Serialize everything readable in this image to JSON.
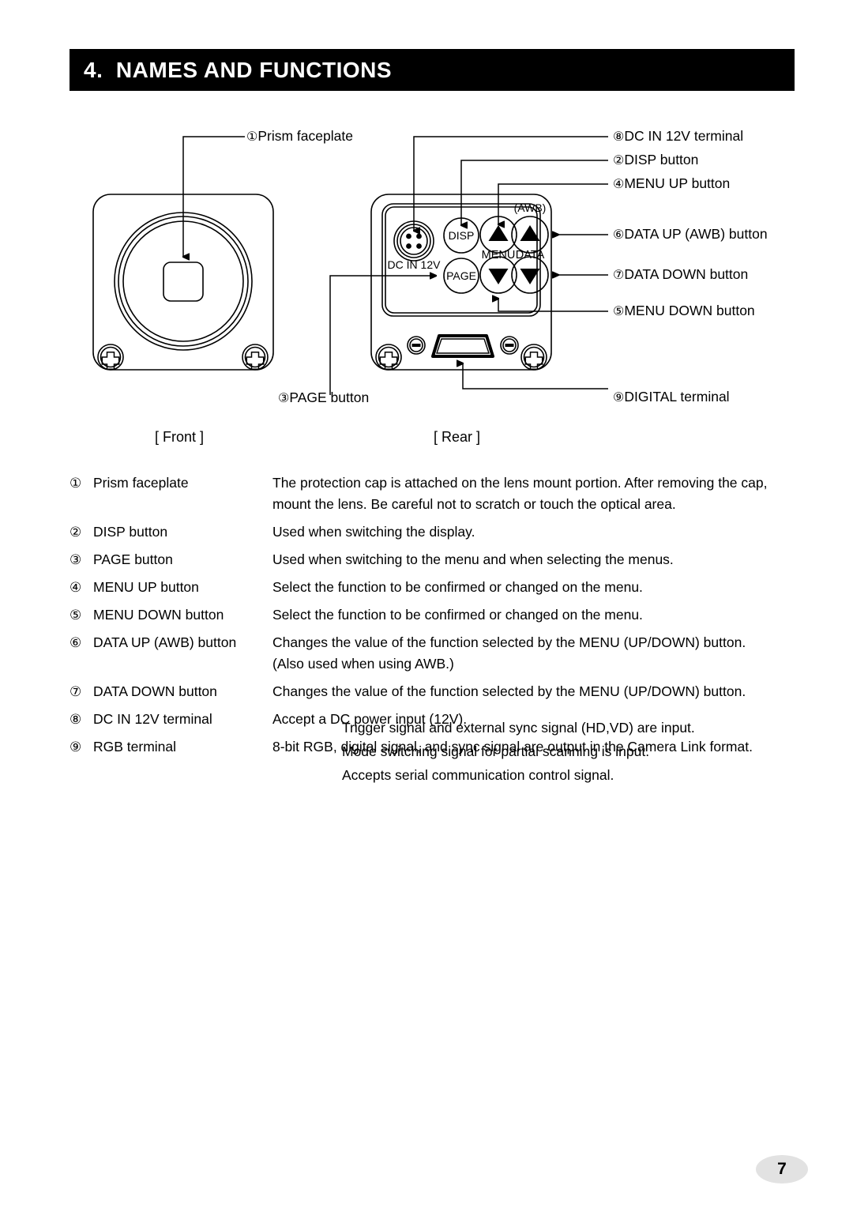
{
  "header": {
    "title": "4.  NAMES AND FUNCTIONS"
  },
  "diagram": {
    "front_view_label": "[ Front ]",
    "rear_view_label": "[ Rear ]",
    "callouts": [
      {
        "num": "①",
        "text": "Prism faceplate"
      },
      {
        "num": "⑧",
        "text": "DC IN 12V terminal"
      },
      {
        "num": "②",
        "text": "DISP button"
      },
      {
        "num": "④",
        "text": "MENU UP button"
      },
      {
        "num": "⑥",
        "text": "DATA UP (AWB) button"
      },
      {
        "num": "⑦",
        "text": "DATA DOWN button"
      },
      {
        "num": "⑤",
        "text": "MENU DOWN button"
      },
      {
        "num": "③",
        "text": "PAGE button"
      },
      {
        "num": "⑨",
        "text": "DIGITAL terminal"
      }
    ],
    "rear_panel_text": {
      "dc_in": "DC IN 12V",
      "disp": "DISP",
      "page": "PAGE",
      "awb": "(AWB)",
      "menu": "MENU",
      "data": "DATA"
    }
  },
  "descriptions": [
    {
      "num": "①",
      "name": "Prism faceplate",
      "lines": [
        "The protection cap is attached on the lens mount portion. After removing the cap,",
        "mount the lens. Be careful not to scratch or touch the optical area."
      ]
    },
    {
      "num": "②",
      "name": "DISP button",
      "lines": [
        "Used when switching the display."
      ]
    },
    {
      "num": "③",
      "name": "PAGE button",
      "lines": [
        "Used when switching to the menu and when selecting the menus."
      ]
    },
    {
      "num": "④",
      "name": "MENU UP button",
      "lines": [
        "Select the function to be confirmed or changed on the menu."
      ]
    },
    {
      "num": "⑤",
      "name": "MENU DOWN button",
      "lines": [
        "Select the function to be confirmed or changed on the menu."
      ]
    },
    {
      "num": "⑥",
      "name": "DATA UP (AWB) button",
      "lines": [
        "Changes the value of the function selected by the MENU (UP/DOWN) button.",
        "(Also used when using AWB.)"
      ]
    },
    {
      "num": "⑦",
      "name": "DATA DOWN button",
      "lines": [
        "Changes the value of the function selected by the MENU (UP/DOWN) button."
      ]
    },
    {
      "num": "⑧",
      "name": "DC IN 12V terminal",
      "lines": [
        "Accept a DC power input (12V)."
      ]
    },
    {
      "num": "⑨",
      "name": "RGB terminal",
      "lines": [
        "8-bit RGB, digital signal, and sync signal are output in the Camera Link format."
      ]
    }
  ],
  "extra_description_lines": [
    "Trigger signal and external sync signal (HD,VD) are input.",
    "Mode switching signal for partial scanning is input.",
    "Accepts serial communication control signal."
  ],
  "footer": {
    "page_number": "7"
  }
}
